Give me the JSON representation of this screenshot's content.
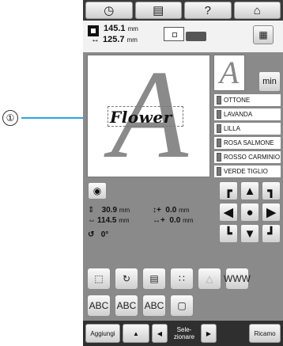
{
  "callout": {
    "number": "①"
  },
  "top_bar": {
    "clock_icon": "clock-icon",
    "doc_icon": "document-icon",
    "help_label": "?",
    "home_icon": "home-icon"
  },
  "size": {
    "height_value": "145.1",
    "width_value": "125.7",
    "unit": "mm"
  },
  "canvas": {
    "big_letter": "A",
    "text": "Flower"
  },
  "preview": {
    "letter": "A"
  },
  "min_label": "min",
  "thread_colors": [
    {
      "name": "OTTONE"
    },
    {
      "name": "LAVANDA"
    },
    {
      "name": "LILLA"
    },
    {
      "name": "ROSA SALMONE"
    },
    {
      "name": "ROSSO CARMINIO"
    },
    {
      "name": "VERDE TIGLIO"
    }
  ],
  "readout": {
    "height": "30.9",
    "width": "114.5",
    "offset_y": "0.0",
    "offset_x": "0.0",
    "unit": "mm",
    "rotation": "0°"
  },
  "arrows": [
    "┏",
    "▲",
    "┓",
    "◀",
    "●",
    "▶",
    "┗",
    "▼",
    "┛"
  ],
  "tools_row1": [
    "⬚",
    "↻",
    "▤",
    "∷",
    "△",
    "WWW"
  ],
  "tools_row2": [
    "ABC",
    "ABC",
    "ABC",
    "▢"
  ],
  "bottom_bar": {
    "add_label": "Aggiungi",
    "select_label_line1": "Sele-",
    "select_label_line2": "zionare",
    "prev_icon": "◀",
    "next_icon": "▶",
    "recall_label": "Ricamo"
  }
}
